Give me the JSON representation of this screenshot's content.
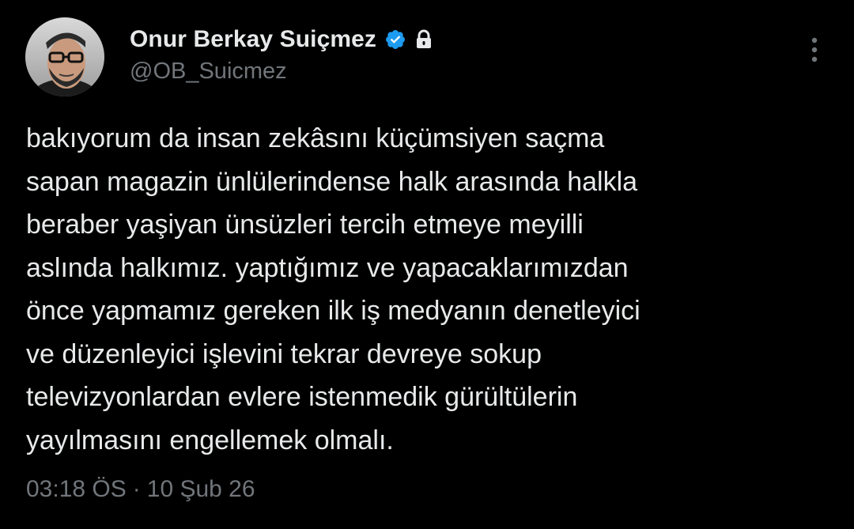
{
  "author": {
    "display_name": "Onur Berkay Suiçmez",
    "handle": "@OB_Suicmez",
    "verified_icon": "verified-badge-icon",
    "protected_icon": "lock-icon",
    "avatar_icon": "avatar"
  },
  "tweet": {
    "text": "bakıyorum da insan zekâsını küçümsiyen saçma\nsapan magazin ünlülerindense halk arasında halkla\nberaber yaşiyan ünsüzleri tercih etmeye meyilli\naslında halkımız. yaptığımız ve yapacaklarımızdan\nönce yapmamız gereken ilk iş medyanın denetleyici\nve düzenleyici işlevini tekrar devreye sokup\ntelevizyonlardan evlere istenmedik gürültülerin\nyayılmasını engellemek olmalı.",
    "time": "03:18 ÖS",
    "separator": "·",
    "date": "10 Şub 26"
  },
  "actions": {
    "more_icon": "more-vertical-icon"
  },
  "colors": {
    "background": "#000000",
    "text": "#e7e9ea",
    "secondary": "#71767b",
    "verified": "#1d9bf0"
  }
}
